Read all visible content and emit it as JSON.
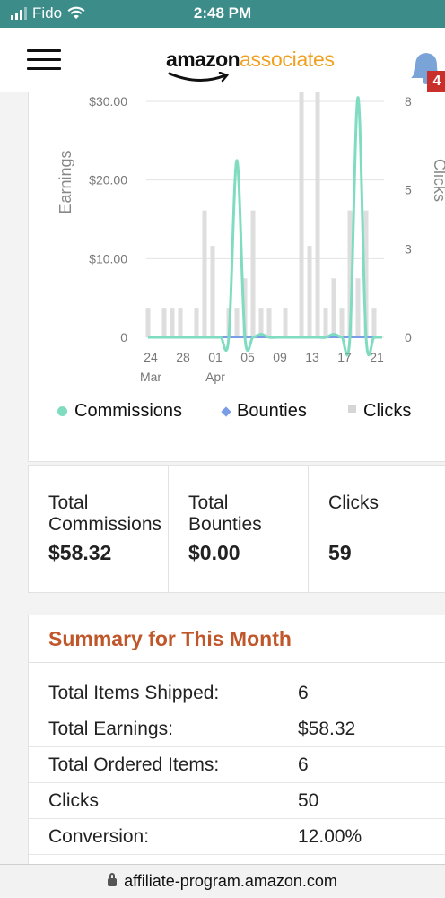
{
  "status_bar": {
    "carrier": "Fido",
    "time": "2:48 PM"
  },
  "app_bar": {
    "logo_primary": "amazon",
    "logo_secondary": "associates",
    "notification_count": "4"
  },
  "chart_data": {
    "type": "bar",
    "left_axis_label": "Earnings",
    "right_axis_label": "Clicks",
    "left_ticks": [
      "$30.00",
      "$20.00",
      "$10.00",
      "0"
    ],
    "left_tick_values": [
      30,
      20,
      10,
      0
    ],
    "right_ticks": [
      "8",
      "5",
      "3",
      "0"
    ],
    "right_tick_values": [
      8,
      5,
      3,
      0
    ],
    "ylim_earnings": [
      0,
      30
    ],
    "ylim_clicks": [
      0,
      8
    ],
    "x_tick_labels": [
      "24",
      "28",
      "01",
      "05",
      "09",
      "13",
      "17",
      "21"
    ],
    "x_month_labels": [
      {
        "text": "Mar",
        "day_index": 0
      },
      {
        "text": "Apr",
        "day_index": 8
      }
    ],
    "x_tick_day_index": [
      0,
      4,
      8,
      12,
      16,
      20,
      24,
      28
    ],
    "day_count": 30,
    "grid": true,
    "series": [
      {
        "name": "Clicks",
        "axis": "right",
        "kind": "bar",
        "values": [
          1,
          0,
          1,
          1,
          1,
          0,
          1,
          4.3,
          3.1,
          0,
          1,
          1,
          2,
          4.3,
          1,
          1,
          0,
          1,
          0,
          8.5,
          3.1,
          8.5,
          1,
          2,
          1,
          4.3,
          2,
          4.3,
          1,
          0
        ]
      },
      {
        "name": "Commissions",
        "axis": "left",
        "kind": "line",
        "values": [
          0,
          0,
          0,
          0,
          0,
          0,
          0,
          0,
          0,
          0,
          0,
          22.5,
          0,
          0,
          0.4,
          0,
          0,
          0,
          0,
          0,
          0,
          0,
          0,
          0.4,
          0,
          0,
          30.5,
          0,
          0,
          0
        ]
      },
      {
        "name": "Bounties",
        "axis": "left",
        "kind": "line",
        "values": [
          0,
          0,
          0,
          0,
          0,
          0,
          0,
          0,
          0,
          0,
          0,
          0,
          0,
          0,
          0,
          0,
          0,
          0,
          0,
          0,
          0,
          0,
          0,
          0,
          0,
          0,
          0,
          0,
          0,
          0
        ]
      }
    ],
    "colors": {
      "commissions": "#7fdcc0",
      "bounties": "#7a9ee6",
      "clicks": "#dedede"
    },
    "legend_position": "bottom"
  },
  "legend": {
    "commissions": "Commissions",
    "bounties": "Bounties",
    "clicks": "Clicks"
  },
  "totals": [
    {
      "label": "Total\nCommissions",
      "value": "$58.32"
    },
    {
      "label": "Total\nBounties",
      "value": "$0.00"
    },
    {
      "label": "Clicks",
      "value": "59"
    }
  ],
  "summary": {
    "title": "Summary for This Month",
    "rows": [
      {
        "label": "Total Items Shipped:",
        "value": "6"
      },
      {
        "label": "Total Earnings:",
        "value": "$58.32"
      },
      {
        "label": "Total Ordered Items:",
        "value": "6"
      },
      {
        "label": "Clicks",
        "value": "50"
      },
      {
        "label": "Conversion:",
        "value": "12.00%"
      }
    ]
  },
  "url_bar": {
    "url": "affiliate-program.amazon.com"
  }
}
